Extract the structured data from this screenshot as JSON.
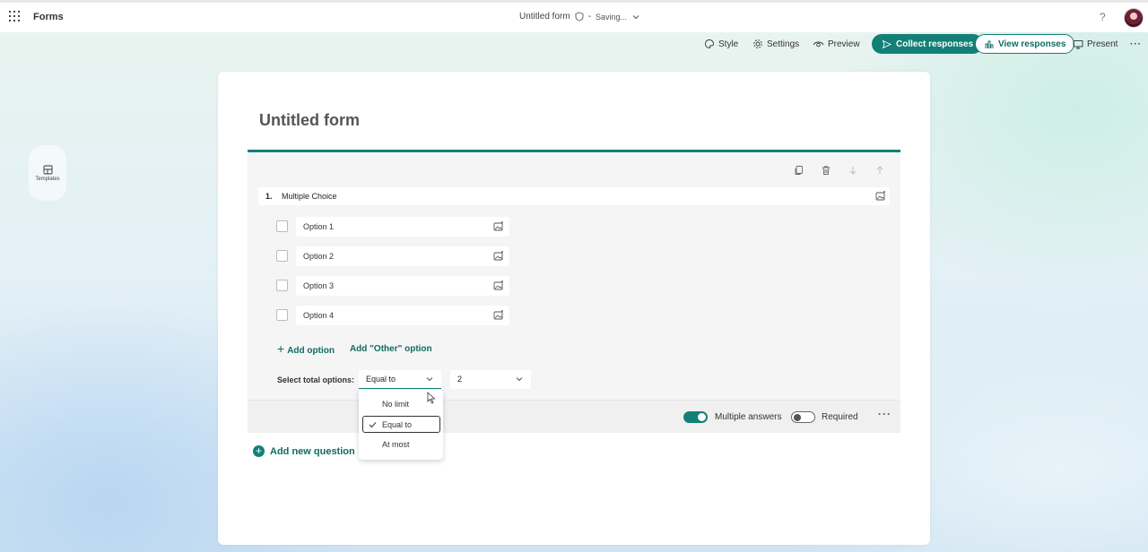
{
  "app": {
    "name": "Forms"
  },
  "header": {
    "form_title": "Untitled form",
    "separator": "-",
    "status": "Saving..."
  },
  "toolbar": {
    "style": "Style",
    "settings": "Settings",
    "preview": "Preview",
    "collect": "Collect responses",
    "view": "View responses",
    "present": "Present"
  },
  "sidebar": {
    "templates": "Templates"
  },
  "form": {
    "title": "Untitled form",
    "question": {
      "number": "1.",
      "type_label": "Multiple Choice",
      "options": [
        "Option 1",
        "Option 2",
        "Option 3",
        "Option 4"
      ],
      "add_option": "Add option",
      "add_other": "Add \"Other\" option",
      "select_total_label": "Select total options:",
      "select_total_value": "Equal to",
      "count_value": "2",
      "multiple_answers_label": "Multiple answers",
      "multiple_answers_on": true,
      "required_label": "Required",
      "required_on": false
    },
    "add_new_question": "Add new question"
  },
  "dropdown": {
    "items": [
      "No limit",
      "Equal to",
      "At most"
    ],
    "selected": "Equal to"
  },
  "colors": {
    "accent": "#128077"
  }
}
